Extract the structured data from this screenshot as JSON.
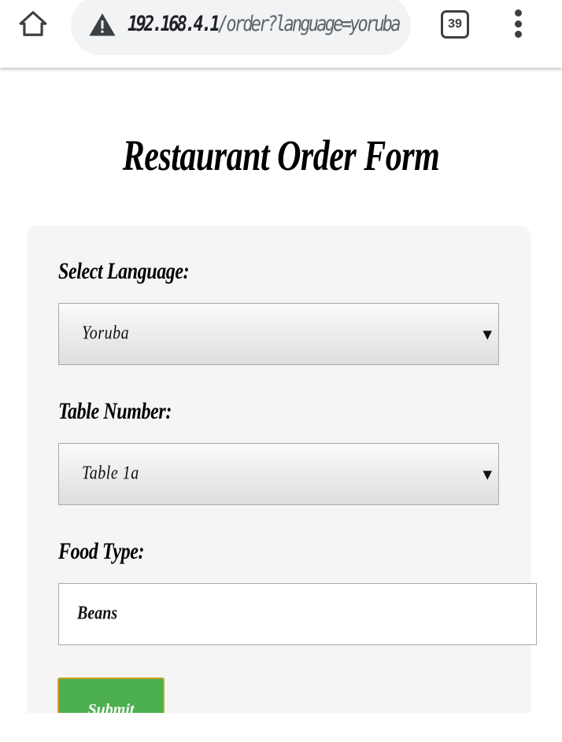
{
  "browser": {
    "url_host": "192.168.4.1",
    "url_path": "/order?language=yoruba",
    "tab_count": "39",
    "icons": {
      "home": "home-icon",
      "warning": "warning-icon",
      "menu": "more-vert-icon"
    }
  },
  "page": {
    "title": "Restaurant Order Form"
  },
  "form": {
    "language": {
      "label": "Select Language:",
      "selected": "Yoruba"
    },
    "table": {
      "label": "Table Number:",
      "selected": "Table 1a"
    },
    "food": {
      "label": "Food Type:",
      "value": "Beans"
    },
    "submit_label": "Submit"
  },
  "colors": {
    "submit_bg": "#4caf50",
    "submit_border": "#c9a227",
    "card_bg": "#f5f5f5"
  }
}
